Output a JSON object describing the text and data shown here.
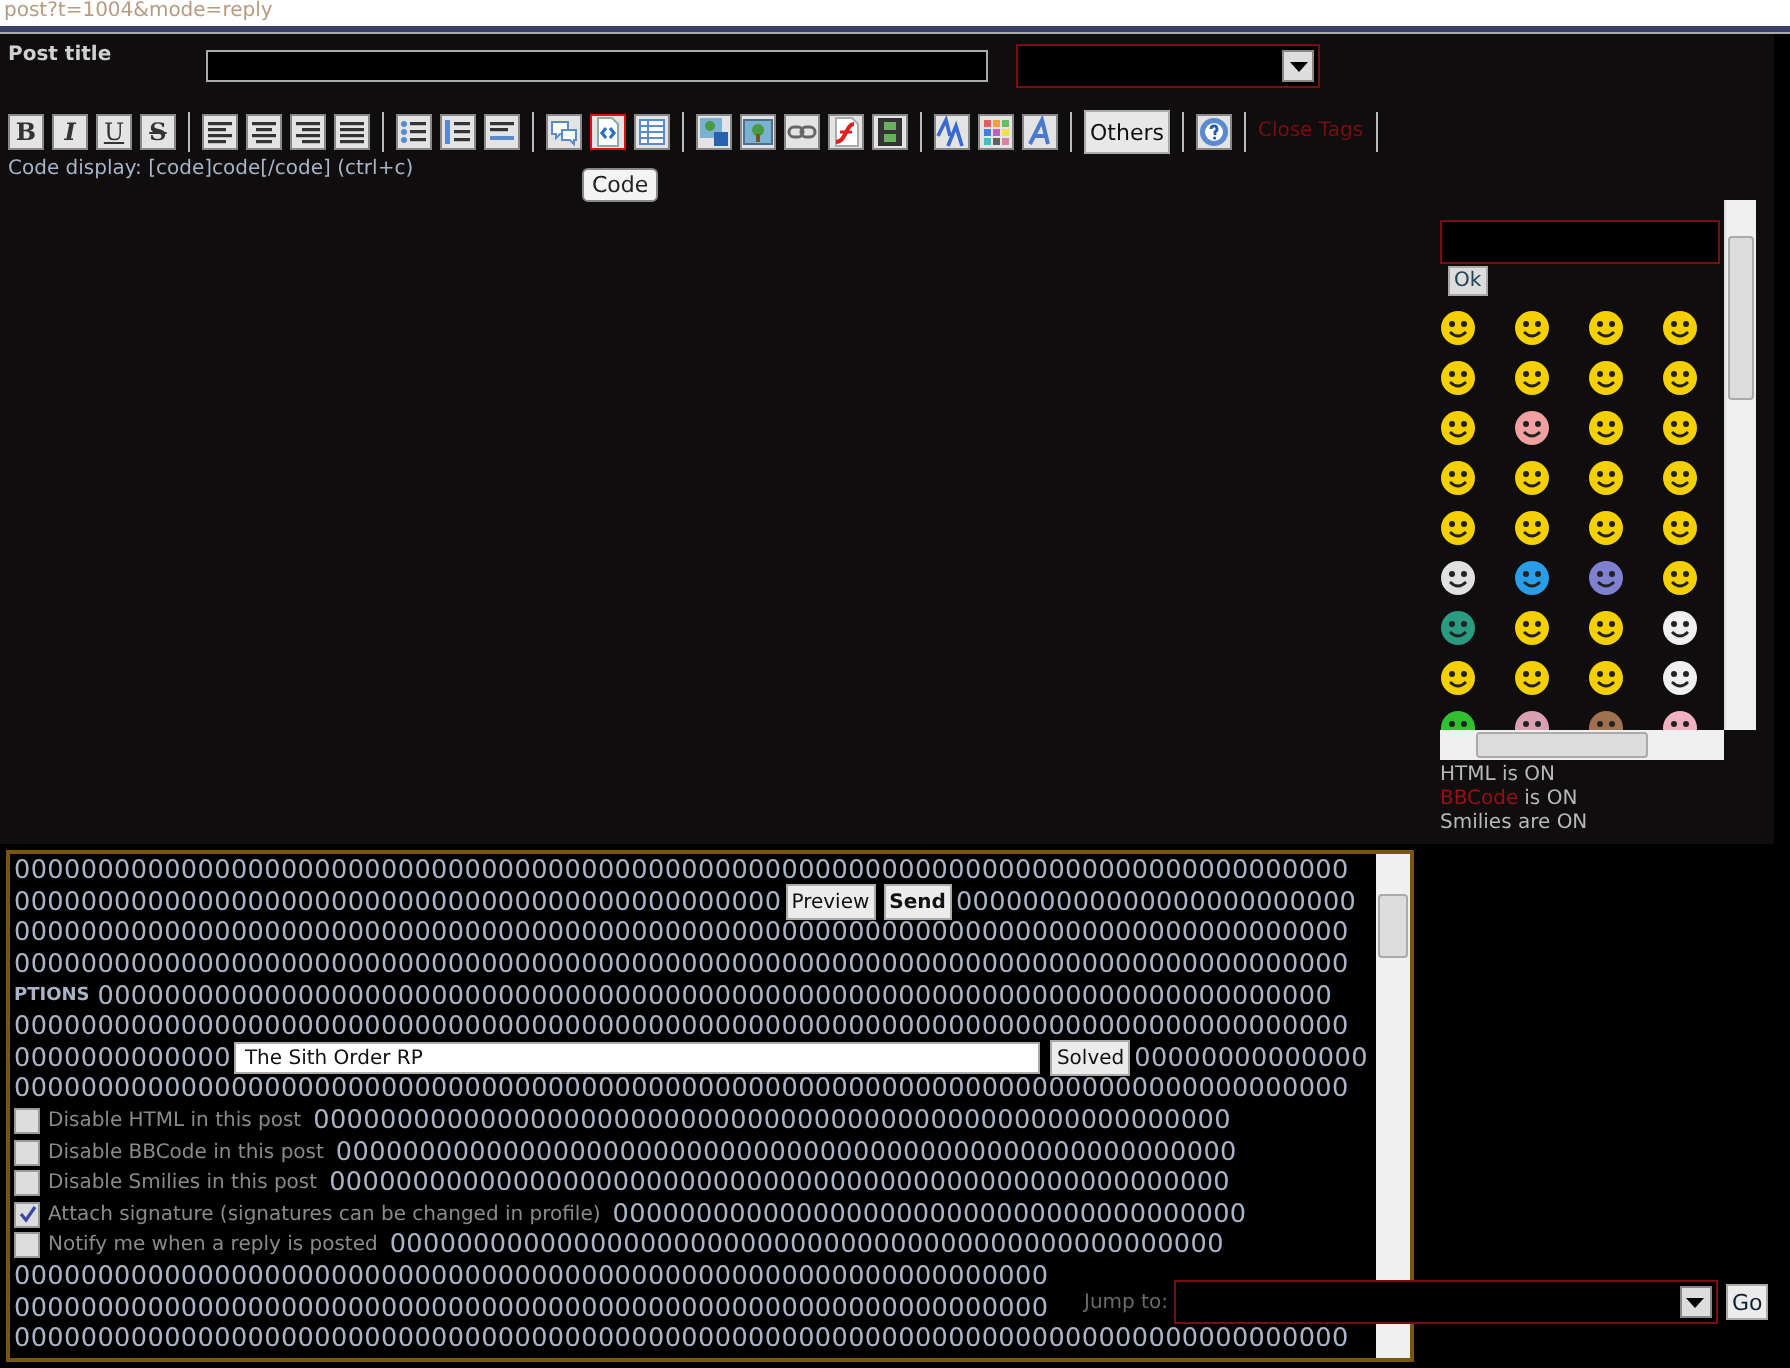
{
  "address_bar": {
    "text": "post?t=1004&mode=reply"
  },
  "post_title": {
    "label": "Post title"
  },
  "toolbar": {
    "groups": [
      [
        {
          "kind": "bold",
          "label": "B",
          "selected": false
        },
        {
          "kind": "italic",
          "label": "I",
          "selected": false
        },
        {
          "kind": "underline",
          "label": "U",
          "selected": false
        },
        {
          "kind": "strike",
          "label": "S",
          "selected": false
        }
      ],
      [
        {
          "kind": "align-left",
          "selected": false
        },
        {
          "kind": "align-center",
          "selected": false
        },
        {
          "kind": "align-right",
          "selected": false
        },
        {
          "kind": "justify",
          "selected": false
        }
      ],
      [
        {
          "kind": "bullet-list",
          "selected": false
        },
        {
          "kind": "numbered-list",
          "selected": false
        },
        {
          "kind": "rule",
          "selected": false
        }
      ],
      [
        {
          "kind": "quote",
          "selected": false
        },
        {
          "kind": "code",
          "selected": true
        },
        {
          "kind": "table",
          "selected": false
        }
      ],
      [
        {
          "kind": "image-upload",
          "selected": false
        },
        {
          "kind": "image",
          "selected": false
        },
        {
          "kind": "link",
          "selected": false
        },
        {
          "kind": "flash",
          "selected": false
        },
        {
          "kind": "video",
          "selected": false
        }
      ],
      [
        {
          "kind": "font-size",
          "selected": false
        },
        {
          "kind": "color",
          "selected": false
        },
        {
          "kind": "font",
          "selected": false
        }
      ],
      [
        {
          "kind": "text",
          "label": "Others",
          "selected": false
        }
      ],
      [
        {
          "kind": "help",
          "selected": false
        }
      ]
    ],
    "close_tags": "Close Tags",
    "tooltip": "Code"
  },
  "code_hint": "Code display: [code]code[/code] (ctrl+c)",
  "smilies": {
    "ok": "Ok",
    "items": [
      {
        "color": "#f5d000"
      },
      {
        "color": "#f5d000"
      },
      {
        "color": "#f5d000"
      },
      {
        "color": "#f5d000"
      },
      {
        "color": "#f5d000"
      },
      {
        "color": "#f5d000"
      },
      {
        "color": "#f5d000"
      },
      {
        "color": "#f5d000"
      },
      {
        "color": "#f5d000"
      },
      {
        "color": "#f0a0a0"
      },
      {
        "color": "#f5d000"
      },
      {
        "color": "#f5d000"
      },
      {
        "color": "#f5d000"
      },
      {
        "color": "#f5d000"
      },
      {
        "color": "#f5d000"
      },
      {
        "color": "#f5d000"
      },
      {
        "color": "#f5d000"
      },
      {
        "color": "#f5d000"
      },
      {
        "color": "#f5d000"
      },
      {
        "color": "#f5d000"
      },
      {
        "color": "#e0e0e0"
      },
      {
        "color": "#2a9de8"
      },
      {
        "color": "#8080d0"
      },
      {
        "color": "#f5d000"
      },
      {
        "color": "#2a9a80"
      },
      {
        "color": "#f5d000"
      },
      {
        "color": "#f5d000"
      },
      {
        "color": "#f0f0f0"
      },
      {
        "color": "#f5d000"
      },
      {
        "color": "#f5d000"
      },
      {
        "color": "#f5d000"
      },
      {
        "color": "#f0f0f0"
      },
      {
        "color": "#30c030"
      },
      {
        "color": "#d8a0b0"
      },
      {
        "color": "#a07050"
      },
      {
        "color": "#f0b0c0"
      }
    ]
  },
  "status": [
    {
      "text": "HTML is ON"
    },
    {
      "link": "BBCode",
      "text": "is ON"
    },
    {
      "text": "Smilies are ON"
    }
  ],
  "editor": {
    "lines": [
      [
        {
          "kind": "text",
          "text": "00000000000000000000000000000000000000000000000000000000000000000000000000000000"
        }
      ],
      [
        {
          "kind": "text",
          "text": "0000000000000000000000000000000000000000000000"
        },
        {
          "kind": "button",
          "label": "Preview"
        },
        {
          "kind": "button",
          "label": "Send",
          "bold": true
        },
        {
          "kind": "text",
          "text": "000000000000000000000000"
        }
      ],
      [
        {
          "kind": "text",
          "text": "00000000000000000000000000000000000000000000000000000000000000000000000000000000"
        }
      ],
      [
        {
          "kind": "text",
          "text": "00000000000000000000000000000000000000000000000000000000000000000000000000000000"
        }
      ],
      [
        {
          "kind": "heading",
          "text": "PTIONS"
        },
        {
          "kind": "text",
          "text": "00000000000000000000000000000000000000000000000000000000000000000000000000"
        }
      ],
      [
        {
          "kind": "text",
          "text": "00000000000000000000000000000000000000000000000000000000000000000000000000000000"
        }
      ],
      [
        {
          "kind": "text",
          "text": "0000000000000"
        },
        {
          "kind": "input",
          "value": "The Sith Order RP"
        },
        {
          "kind": "button",
          "label": "Solved"
        },
        {
          "kind": "text",
          "text": "00000000000000"
        }
      ],
      [
        {
          "kind": "text",
          "text": "00000000000000000000000000000000000000000000000000000000000000000000000000000000"
        }
      ],
      [
        {
          "kind": "checkbox",
          "checked": false,
          "label": "Disable HTML in this post"
        },
        {
          "kind": "text",
          "text": "0000000000000000000000000000000000000000000000000000000"
        }
      ],
      [
        {
          "kind": "checkbox",
          "checked": false,
          "label": "Disable BBCode in this post"
        },
        {
          "kind": "text",
          "text": "000000000000000000000000000000000000000000000000000000"
        }
      ],
      [
        {
          "kind": "checkbox",
          "checked": false,
          "label": "Disable Smilies in this post"
        },
        {
          "kind": "text",
          "text": "000000000000000000000000000000000000000000000000000000"
        }
      ],
      [
        {
          "kind": "checkbox",
          "checked": true,
          "label": "Attach signature (signatures can be changed in profile)"
        },
        {
          "kind": "text",
          "text": "00000000000000000000000000000000000000"
        }
      ],
      [
        {
          "kind": "checkbox",
          "checked": false,
          "label": "Notify me when a reply is posted"
        },
        {
          "kind": "text",
          "text": "00000000000000000000000000000000000000000000000000"
        }
      ],
      [
        {
          "kind": "text",
          "text": "00000000000000000000000000000000000000000000000000000000000000"
        }
      ],
      [
        {
          "kind": "text",
          "text": "00000000000000000000000000000000000000000000000000000000000000"
        }
      ],
      [
        {
          "kind": "text",
          "text": "00000000000000000000000000000000000000000000000000000000000000000000000000000000"
        }
      ]
    ]
  },
  "jump": {
    "label": "Jump to:",
    "button": "Go"
  }
}
